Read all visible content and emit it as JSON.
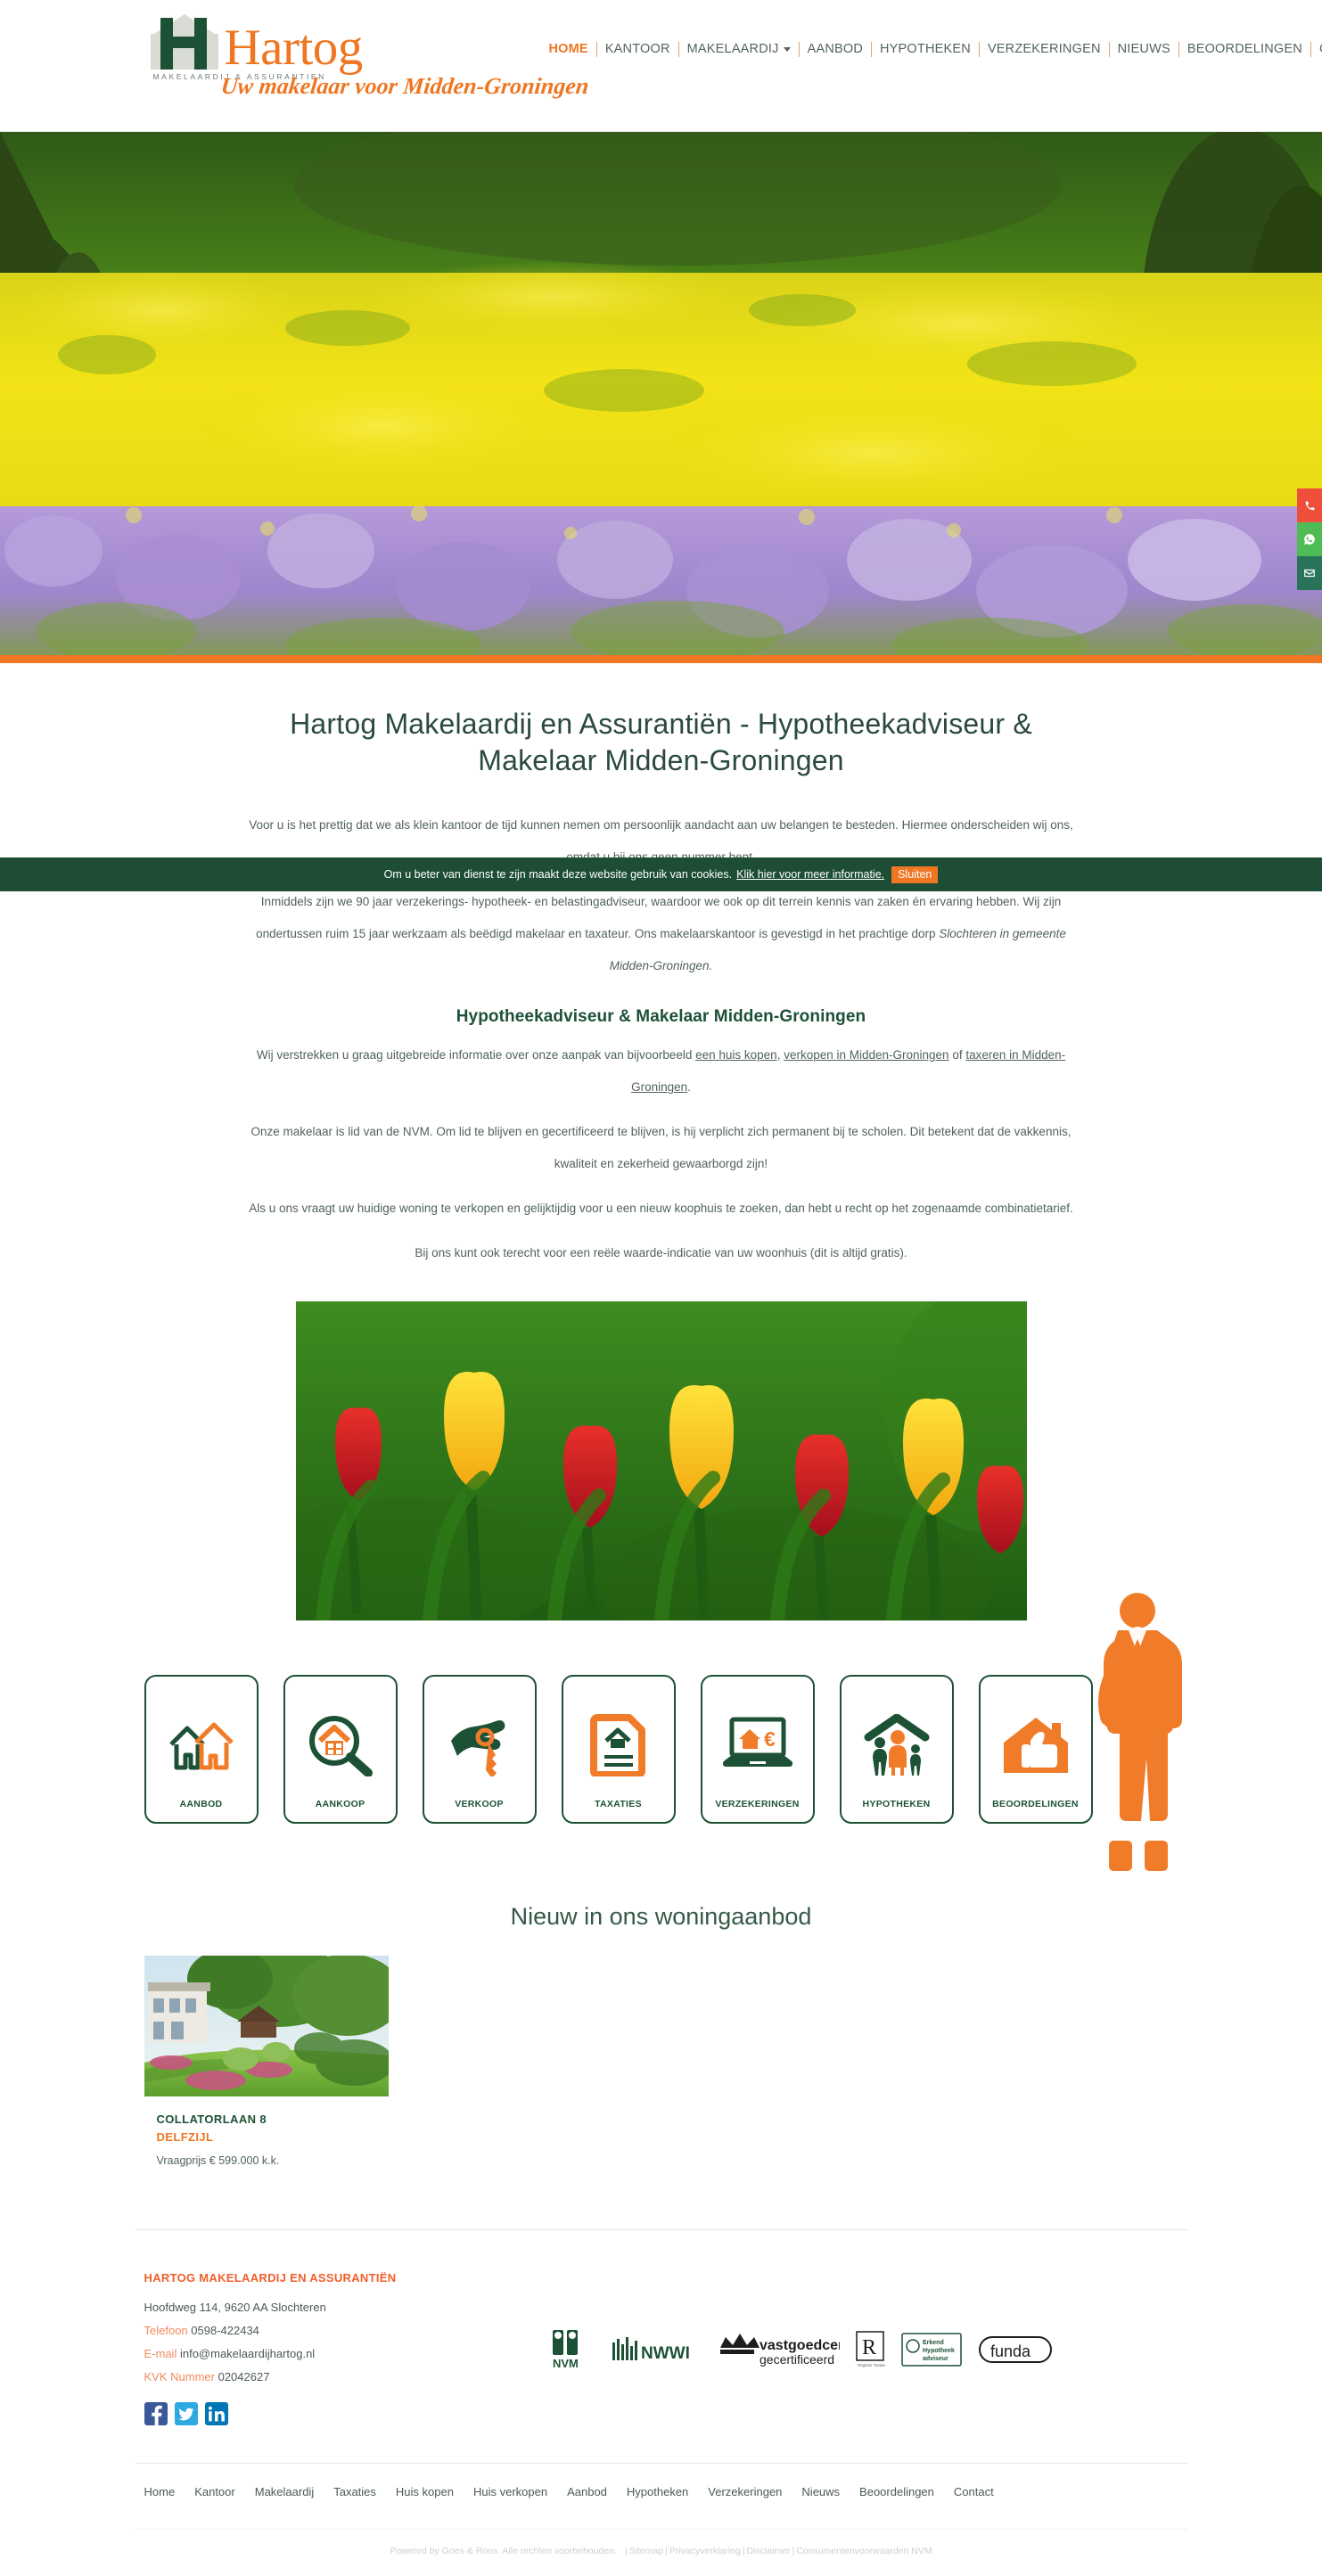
{
  "brand": {
    "name": "Hartog",
    "subtitle": "MAKELAARDIJ & ASSURANTIEN",
    "tagline": "Uw makelaar voor Midden-Groningen",
    "orange": "#ef7622",
    "green": "#1d5135"
  },
  "nav": {
    "items": [
      {
        "label": "HOME",
        "active": true,
        "caret": false
      },
      {
        "label": "KANTOOR",
        "active": false,
        "caret": false
      },
      {
        "label": "MAKELAARDIJ",
        "active": false,
        "caret": true
      },
      {
        "label": "AANBOD",
        "active": false,
        "caret": false
      },
      {
        "label": "HYPOTHEKEN",
        "active": false,
        "caret": false
      },
      {
        "label": "VERZEKERINGEN",
        "active": false,
        "caret": false
      },
      {
        "label": "NIEUWS",
        "active": false,
        "caret": false
      },
      {
        "label": "BEOORDELINGEN",
        "active": false,
        "caret": false
      },
      {
        "label": "CONTACT",
        "active": false,
        "caret": false
      }
    ]
  },
  "side_tabs": [
    {
      "name": "phone",
      "color": "#ef4f3a"
    },
    {
      "name": "whatsapp",
      "color": "#4fbb54"
    },
    {
      "name": "mail",
      "color": "#29735b"
    }
  ],
  "hero": {
    "alt": "Veld met gele en paarse krokussen onder bomen"
  },
  "main": {
    "title": "Hartog Makelaardij en Assurantiën - Hypotheekadviseur & Makelaar Midden-Groningen",
    "paragraph1": "Voor u is het prettig dat we als klein kantoor de tijd kunnen nemen om persoonlijk aandacht aan uw belangen te besteden. Hiermee onderscheiden wij ons, omdat u bij ons geen nummer bent.",
    "paragraph2_a": "Inmiddels zijn we 90 jaar verzekerings- hypotheek- en belastingadviseur, waardoor we ook op dit terrein kennis van zaken én ervaring hebben. Wij zijn ondertussen ruim 15 jaar werkzaam als beëdigd makelaar en taxateur. Ons makelaarskantoor is gevestigd in het prachtige dorp ",
    "paragraph2_em": "Slochteren in gemeente Midden-Groningen.",
    "subtitle": "Hypotheekadviseur & Makelaar Midden-Groningen",
    "paragraph3_a": "Wij verstrekken u graag uitgebreide informatie over onze aanpak van bijvoorbeeld ",
    "paragraph3_link1": "een huis kopen",
    "paragraph3_b": ", ",
    "paragraph3_link2": "verkopen in Midden-Groningen",
    "paragraph3_c": " of ",
    "paragraph3_link3": "taxeren in Midden-Groningen",
    "paragraph3_d": ".",
    "paragraph4": "Onze makelaar is lid van de NVM. Om lid te blijven en gecertificeerd te blijven, is hij verplicht zich permanent bij te scholen. Dit betekent dat de vakkennis, kwaliteit en zekerheid gewaarborgd zijn!",
    "paragraph5": "Als u ons vraagt uw huidige woning te verkopen en gelijktijdig voor u een nieuw koophuis te zoeken, dan hebt u recht op het zogenaamde combinatietarief.",
    "paragraph6": "Bij ons kunt ook terecht voor een reële waarde-indicatie van uw woonhuis (dit is altijd gratis)."
  },
  "cookie": {
    "text": "Om u beter van dienst te zijn maakt deze website gebruik van cookies.",
    "link": "Klik hier voor meer informatie.",
    "close_label": "Sluiten"
  },
  "tulips": {
    "alt": "Gele en rode tulpen"
  },
  "services": [
    {
      "label": "AANBOD",
      "icon": "two-houses-icon"
    },
    {
      "label": "AANKOOP",
      "icon": "house-magnifier-icon"
    },
    {
      "label": "VERKOOP",
      "icon": "hand-key-icon"
    },
    {
      "label": "TAXATIES",
      "icon": "house-document-icon"
    },
    {
      "label": "VERZEKERINGEN",
      "icon": "laptop-house-euro-icon"
    },
    {
      "label": "HYPOTHEKEN",
      "icon": "family-roof-icon"
    },
    {
      "label": "BEOORDELINGEN",
      "icon": "house-thumbsup-icon"
    }
  ],
  "listings": {
    "title": "Nieuw in ons woningaanbod",
    "items": [
      {
        "street": "COLLATORLAAN 8",
        "city": "DELFZIJL",
        "price": "Vraagprijs € 599.000 k.k."
      }
    ]
  },
  "footer": {
    "company": "HARTOG MAKELAARDIJ EN ASSURANTIËN",
    "address": "Hoofdweg 114, 9620 AA Slochteren",
    "phone_label": "Telefoon",
    "phone": "0598-422434",
    "email_label": "E-mail",
    "email": "info@makelaardijhartog.nl",
    "kvk_label": "KVK Nummer",
    "kvk": "02042627",
    "social": [
      {
        "name": "facebook",
        "glyph": "f"
      },
      {
        "name": "twitter",
        "glyph": "t"
      },
      {
        "name": "linkedin",
        "glyph": "in"
      }
    ],
    "badges": [
      {
        "name": "nvm",
        "label": "NVM"
      },
      {
        "name": "nwwi",
        "label": "NWWI"
      },
      {
        "name": "vastgoedcert",
        "label": "vastgoedcert",
        "sub": "gecertificeerd"
      },
      {
        "name": "rijksmonument",
        "label": "R"
      },
      {
        "name": "erkend-hypotheekadviseur",
        "label": "Erkend",
        "sub": "Hypotheek adviseur"
      },
      {
        "name": "funda",
        "label": "funda"
      }
    ],
    "nav": [
      "Home",
      "Kantoor",
      "Makelaardij",
      "Taxaties",
      "Huis kopen",
      "Huis verkopen",
      "Aanbod",
      "Hypotheken",
      "Verzekeringen",
      "Nieuws",
      "Beoordelingen",
      "Contact"
    ],
    "copyright_a": "Powered by Goes & Roos. Alle rechten voorbehouden.",
    "copy_links": [
      "Sitemap",
      "Privacyverklaring",
      "Disclaimer",
      "Consumentenvoorwaarden NVM"
    ]
  }
}
